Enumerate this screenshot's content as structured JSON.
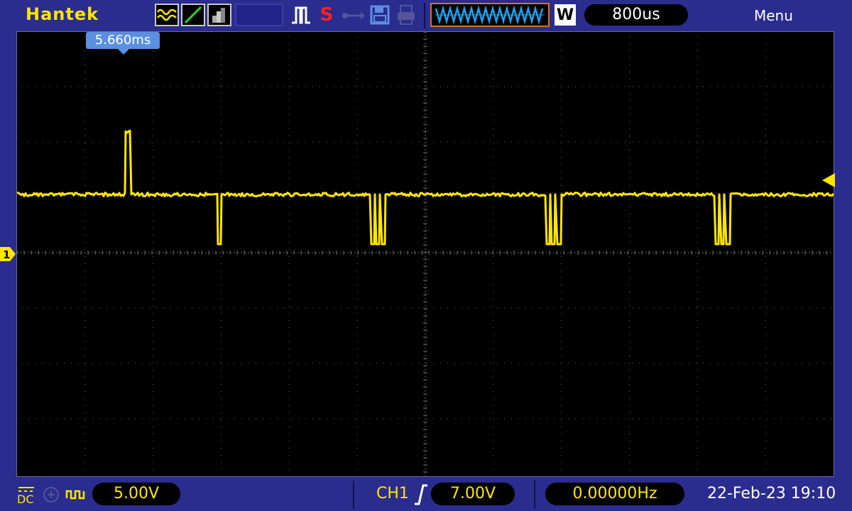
{
  "header": {
    "brand": "Hantek",
    "timebase": "800us",
    "menu_label": "Menu",
    "mode_badge": "W",
    "icons": [
      "wave-mode-icon",
      "ramp-icon",
      "persistence-icon",
      "pulse-trigger-icon",
      "s-status-icon",
      "usb-icon",
      "save-icon",
      "print-icon"
    ]
  },
  "display": {
    "cursor_readout": "5.660ms",
    "channel_marker": "1",
    "trace_color": "#ffe600",
    "grid_color": "#6a6a6a"
  },
  "footer": {
    "coupling": "DC",
    "ch1_scale": "5.00V",
    "trigger_source": "CH1",
    "trigger_level": "7.00V",
    "frequency": "0.00000Hz",
    "datetime": "22-Feb-23 19:10"
  },
  "colors": {
    "panel": "#2a2c8e",
    "accent_yellow": "#ffe600",
    "cursor_tag": "#5b8fe0",
    "save_icon": "#5b8fe0",
    "s_icon": "#ff2020"
  }
}
